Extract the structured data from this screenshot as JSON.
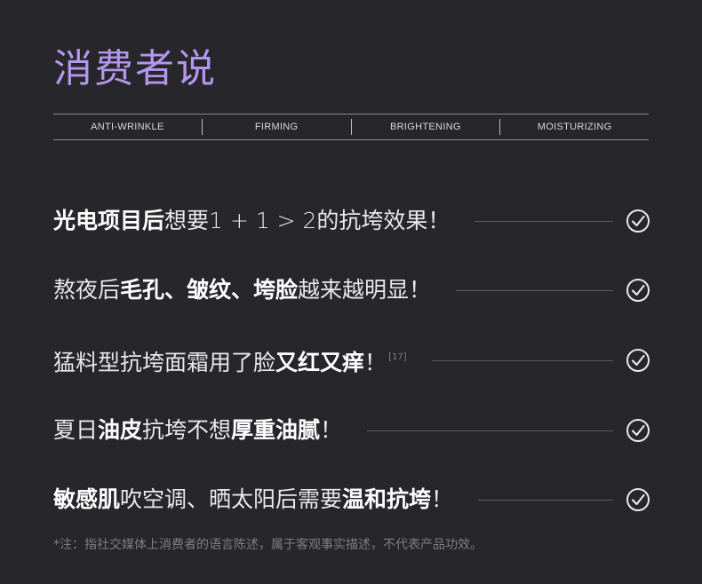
{
  "title": "消费者说",
  "tags": [
    "ANTI-WRINKLE",
    "FIRMING",
    "BRIGHTENING",
    "MOISTURIZING"
  ],
  "items": [
    {
      "parts": [
        {
          "t": "光电项目后",
          "b": true
        },
        {
          "t": "想要1 + 1 > 2的抗垮效果！",
          "b": false
        }
      ]
    },
    {
      "parts": [
        {
          "t": "熬夜后",
          "b": false
        },
        {
          "t": "毛孔、皱纹、垮脸",
          "b": true
        },
        {
          "t": "越来越明显！",
          "b": false
        }
      ]
    },
    {
      "parts": [
        {
          "t": "猛料型抗垮面霜用了脸",
          "b": false
        },
        {
          "t": "又红又痒",
          "b": true
        },
        {
          "t": "！",
          "b": false
        }
      ],
      "sup": "[17]"
    },
    {
      "parts": [
        {
          "t": "夏日",
          "b": false
        },
        {
          "t": "油皮",
          "b": true
        },
        {
          "t": "抗垮不想",
          "b": false
        },
        {
          "t": "厚重油腻",
          "b": true
        },
        {
          "t": "！",
          "b": false
        }
      ]
    },
    {
      "parts": [
        {
          "t": "敏感肌",
          "b": true
        },
        {
          "t": "吹空调、晒太阳后需要",
          "b": false
        },
        {
          "t": "温和抗垮",
          "b": true
        },
        {
          "t": "！",
          "b": false
        }
      ]
    }
  ],
  "note": "*注：指社交媒体上消费者的语言陈述，属于客观事实描述，不代表产品功效。",
  "colors": {
    "background": "#26262b",
    "accent": "#b496ee",
    "text": "#e9e9ec"
  },
  "icons": {
    "row_check": "check-circle-icon"
  }
}
